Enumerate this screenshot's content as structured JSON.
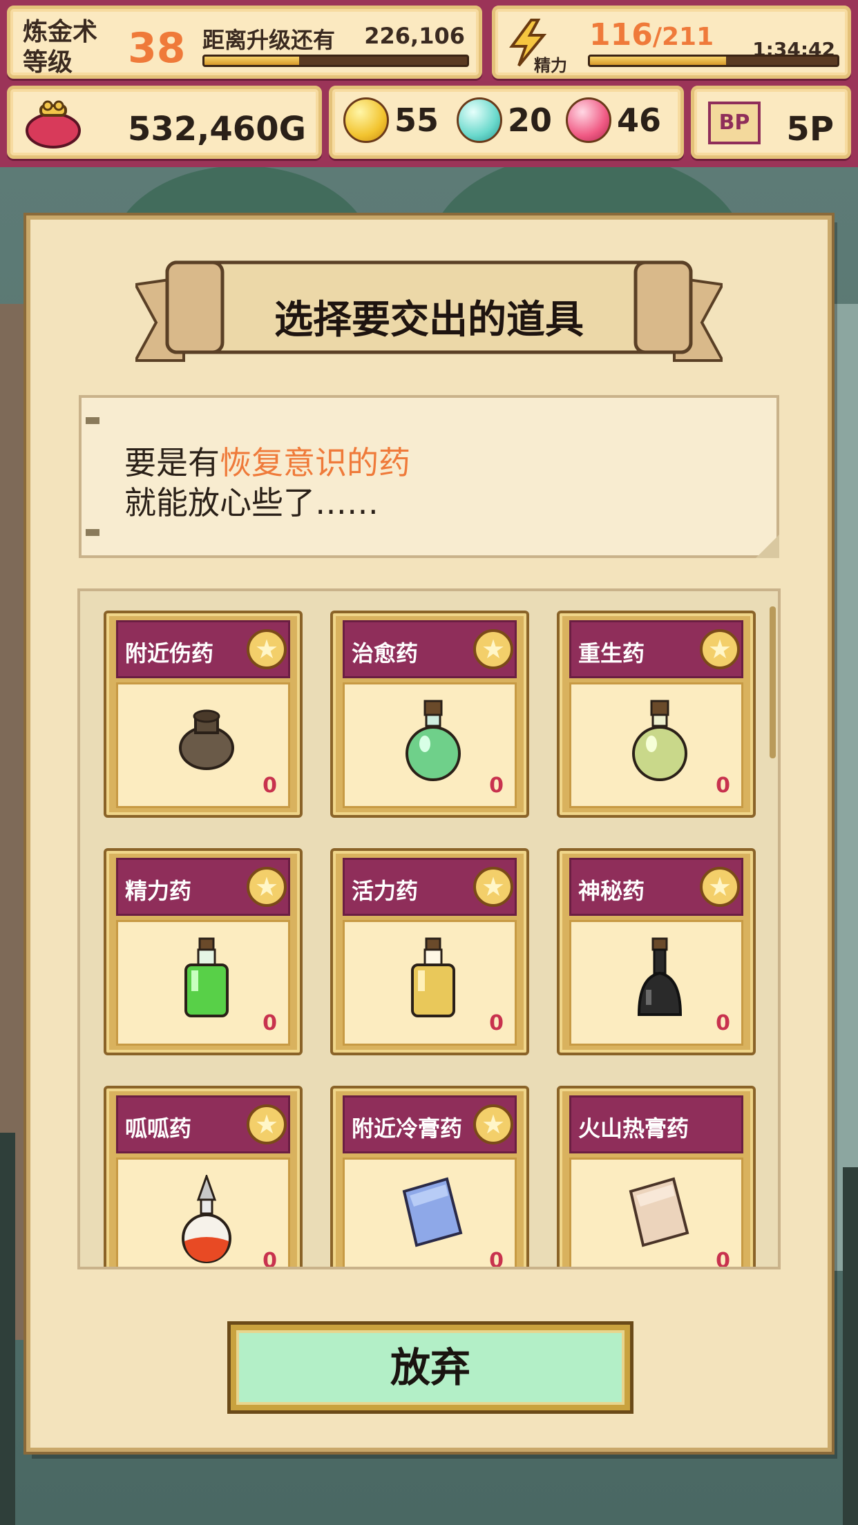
{
  "hud": {
    "alchemy_level_label": "炼金术等级",
    "alchemy_level": "38",
    "next_level_caption": "距离升级还有",
    "next_level_remaining": "226,106",
    "next_level_progress": 0.36,
    "energy_current": "116",
    "energy_max": "/211",
    "energy_label": "精力",
    "energy_timer": "1:34:42",
    "energy_progress": 0.55,
    "gold": "532,460G",
    "orbs": [
      {
        "color": "yellow",
        "count": "55"
      },
      {
        "color": "cyan",
        "count": "20"
      },
      {
        "color": "pink",
        "count": "46"
      }
    ],
    "bp_icon": "BP",
    "bp_points": "5P"
  },
  "dialog": {
    "title": "选择要交出的道具",
    "message_line1_prefix": "要是有",
    "message_line1_highlight": "恢复意识的药",
    "message_line2": "就能放心些了……"
  },
  "items": [
    {
      "name": "附近伤药",
      "count": "0",
      "icon": "pot-icon",
      "star": true
    },
    {
      "name": "治愈药",
      "count": "0",
      "icon": "green-round-potion-icon",
      "star": true
    },
    {
      "name": "重生药",
      "count": "0",
      "icon": "yellow-green-round-potion-icon",
      "star": true
    },
    {
      "name": "精力药",
      "count": "0",
      "icon": "green-square-potion-icon",
      "star": true
    },
    {
      "name": "活力药",
      "count": "0",
      "icon": "yellow-square-potion-icon",
      "star": true
    },
    {
      "name": "神秘药",
      "count": "0",
      "icon": "black-flask-icon",
      "star": true
    },
    {
      "name": "呱呱药",
      "count": "0",
      "icon": "red-drop-flask-icon",
      "star": true
    },
    {
      "name": "附近冷膏药",
      "count": "0",
      "icon": "blue-plaster-icon",
      "star": true
    },
    {
      "name": "火山热膏药",
      "count": "0",
      "icon": "beige-plaster-icon",
      "star": false
    }
  ],
  "buttons": {
    "give_up": "放弃"
  },
  "colors": {
    "hud_bg": "#9b3458",
    "highlight": "#ef7a3a",
    "card_header": "#8f2e5a",
    "button_bg": "#b3efc7"
  }
}
